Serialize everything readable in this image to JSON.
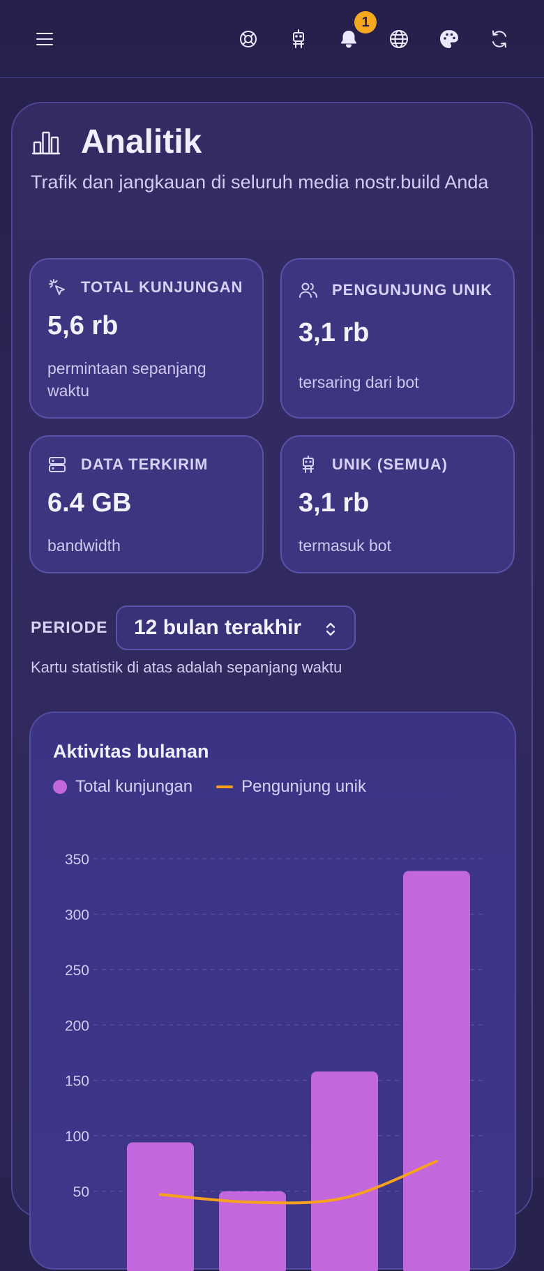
{
  "topbar": {
    "menu_icon": "menu-icon",
    "icons": [
      "lifebuoy-icon",
      "robot-icon",
      "bell-icon",
      "globe-icon",
      "palette-icon",
      "refresh-icon"
    ],
    "notification_count": "1",
    "badge_color": "#f6a91e"
  },
  "page": {
    "title": "Analitik",
    "subtitle": "Trafik dan jangkauan di seluruh media nostr.build Anda"
  },
  "stats": [
    {
      "icon": "cursor-click-icon",
      "label": "TOTAL KUNJUNGAN",
      "value": "5,6 rb",
      "note": "permintaan sepanjang waktu"
    },
    {
      "icon": "users-icon",
      "label": "PENGUNJUNG UNIK",
      "value": "3,1 rb",
      "note": "tersaring dari bot"
    },
    {
      "icon": "server-icon",
      "label": "DATA TERKIRIM",
      "value": "6.4 GB",
      "note": "bandwidth"
    },
    {
      "icon": "robot-icon",
      "label": "UNIK (SEMUA)",
      "value": "3,1 rb",
      "note": "termasuk bot"
    }
  ],
  "period": {
    "label": "PERIODE",
    "selected": "12 bulan terakhir",
    "note": "Kartu statistik di atas adalah sepanjang waktu"
  },
  "chart_data": {
    "type": "bar",
    "title": "Aktivitas bulanan",
    "series": [
      {
        "name": "Total kunjungan",
        "type": "bar",
        "color": "#c268dc",
        "values": [
          94,
          50,
          158,
          339
        ]
      },
      {
        "name": "Pengunjung unik",
        "type": "line",
        "color": "#f6a21e",
        "values": [
          47,
          40,
          44,
          77
        ]
      }
    ],
    "y_ticks": [
      350,
      300,
      250,
      200,
      150,
      100,
      50
    ],
    "ylim": [
      0,
      350
    ],
    "grid": true,
    "legend": "top-left"
  }
}
